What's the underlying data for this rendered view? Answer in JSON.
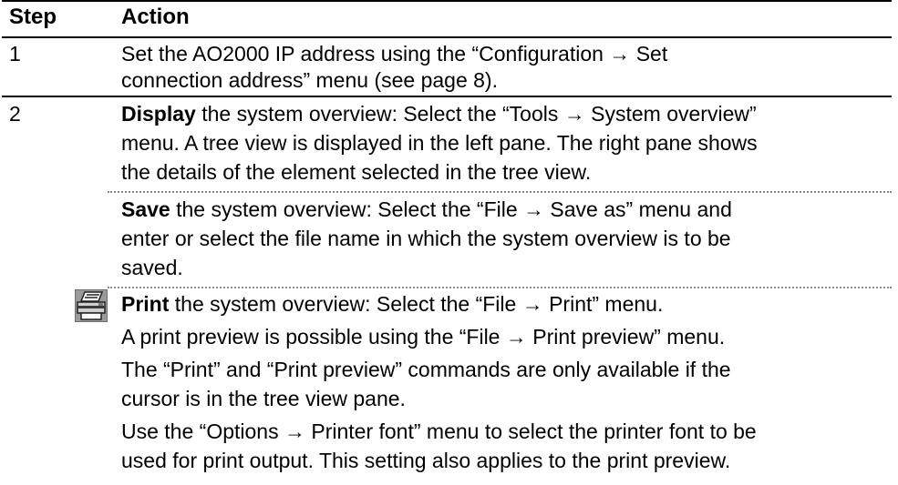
{
  "header": {
    "step": "Step",
    "action": "Action"
  },
  "rows": [
    {
      "step": "1",
      "lines": [
        "Set the AO2000 IP address using the “Configuration → Set",
        "connection address” menu (see page 8)."
      ]
    },
    {
      "step": "2",
      "display": {
        "bold": "Display",
        "lines": [
          " the system overview: Select the “Tools → System overview”",
          "menu. A tree view is displayed in the left pane. The right pane shows",
          "the details of the element selected in the tree view."
        ]
      },
      "save": {
        "bold": "Save",
        "lines": [
          " the system overview: Select the “File → Save as” menu and",
          "enter or select the file name in which the system overview is to be",
          "saved."
        ]
      },
      "print": {
        "bold": "Print",
        "lines": [
          " the system overview: Select the “File → Print” menu.",
          "A print preview is possible using the “File → Print preview” menu.",
          "The “Print” and “Print preview” commands are only available if the",
          "cursor is in the tree view pane.",
          "Use the “Options → Printer font” menu to select the printer font to be",
          "used for print output. This setting also applies to the print preview."
        ]
      }
    }
  ],
  "icons": {
    "print": "printer-icon"
  }
}
